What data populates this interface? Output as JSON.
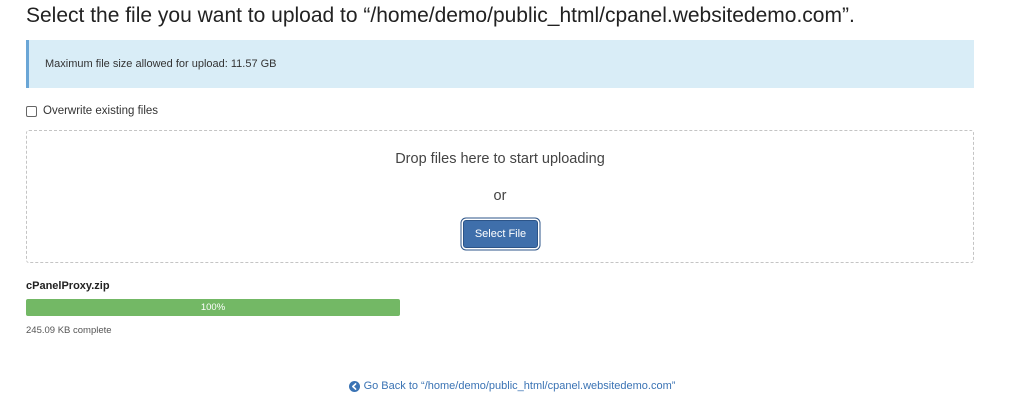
{
  "page": {
    "title": "Select the file you want to upload to “/home/demo/public_html/cpanel.websitedemo.com”."
  },
  "info": {
    "max_size_text": "Maximum file size allowed for upload: 11.57 GB"
  },
  "overwrite": {
    "label": "Overwrite existing files",
    "checked": false
  },
  "dropzone": {
    "prompt": "Drop files here to start uploading",
    "or_text": "or",
    "select_button_label": "Select File"
  },
  "upload": {
    "file_name": "cPanelProxy.zip",
    "progress_percent": 100,
    "progress_label": "100%",
    "status_text": "245.09 KB complete"
  },
  "footer": {
    "go_back_label": "Go Back to “/home/demo/public_html/cpanel.websitedemo.com”",
    "go_back_icon": "circle-arrow-left-icon"
  },
  "colors": {
    "info_bg": "#d9edf7",
    "primary_button": "#3f6fab",
    "progress_success": "#73b865",
    "link": "#3a73b4"
  }
}
